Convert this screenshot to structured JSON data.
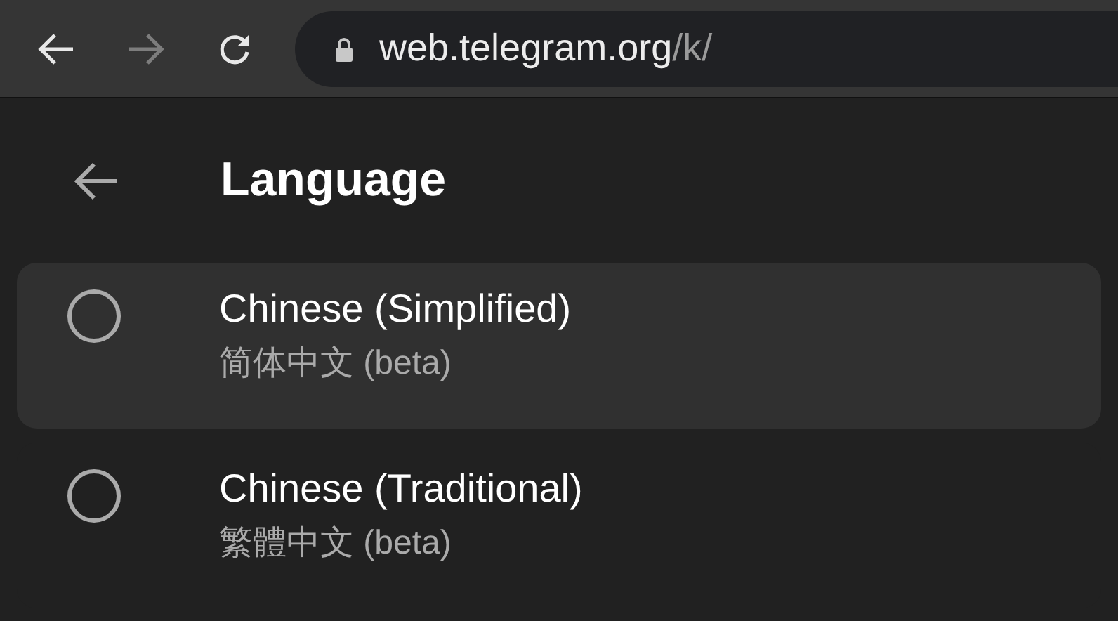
{
  "browser": {
    "forward_disabled": true,
    "url_host": "web.telegram.org",
    "url_path": "/k/"
  },
  "header": {
    "title": "Language"
  },
  "languages": [
    {
      "name": "Chinese (Simplified)",
      "native": "简体中文 (beta)",
      "selected": false,
      "highlighted": true
    },
    {
      "name": "Chinese (Traditional)",
      "native": "繁體中文 (beta)",
      "selected": false,
      "highlighted": false
    }
  ]
}
